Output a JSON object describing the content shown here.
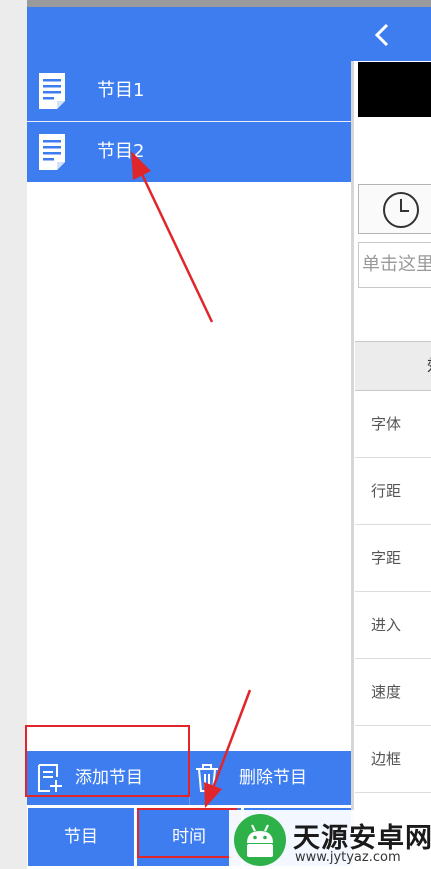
{
  "topbar": {
    "back_icon": "chevron-left-icon"
  },
  "program_list": {
    "items": [
      {
        "label": "节目1",
        "icon": "document-icon"
      },
      {
        "label": "节目2",
        "icon": "document-icon"
      }
    ]
  },
  "right_panel": {
    "text_hint": "单击这里",
    "clock_icon": "clock-icon",
    "attributes": [
      "字体",
      "行距",
      "字距",
      "进入",
      "速度",
      "边框"
    ]
  },
  "actions": {
    "add_label": "添加节目",
    "delete_label": "删除节目",
    "add_icon": "add-document-icon",
    "delete_icon": "trash-icon"
  },
  "tabs": [
    {
      "label": "节目"
    },
    {
      "label": "时间"
    },
    {
      "label": ""
    }
  ],
  "watermark": {
    "title": "天源安卓网",
    "url": "www.jytyaz.com"
  },
  "colors": {
    "primary": "#3e7df0",
    "highlight": "#e0262b",
    "logo_green": "#2fb14a"
  }
}
